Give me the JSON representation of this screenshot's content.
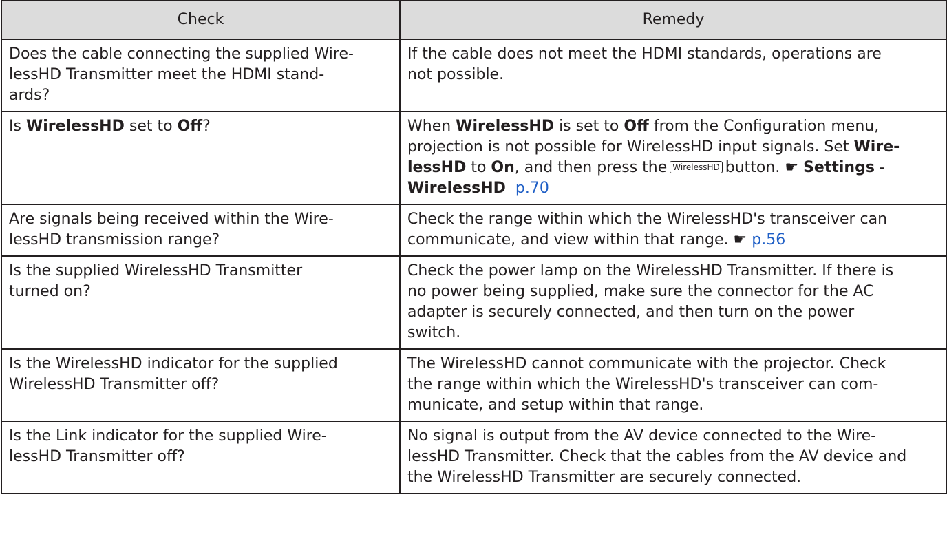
{
  "table": {
    "headers": [
      "Check",
      "Remedy"
    ],
    "rows": [
      {
        "check": [
          "Does the cable connecting the supplied Wire-",
          "lessHD Transmitter meet the HDMI stand-",
          "ards?"
        ],
        "remedy": [
          "If the cable does not meet the HDMI standards, operations are",
          "not possible."
        ]
      },
      {
        "check": {
          "t1": "Is ",
          "b1": "WirelessHD",
          "t2": " set to ",
          "b2": "Off",
          "t3": "?"
        },
        "remedy": {
          "t1": "When ",
          "b1": "WirelessHD",
          "t2": " is set to ",
          "b2": "Off",
          "t3": " from the Configuration menu,",
          "t4": "projection is not possible for WirelessHD input signals. Set ",
          "b3": "Wire-",
          "b4": "lessHD",
          "t5": " to ",
          "b5": "On",
          "t6": ", and then press the",
          "button": "WirelessHD",
          "t7": "button.",
          "finger": "☛",
          "b6": "Settings",
          "t8": " -",
          "b7": "WirelessHD",
          "link": "p.70"
        }
      },
      {
        "check": [
          "Are signals being received within the Wire-",
          "lessHD transmission range?"
        ],
        "remedy": {
          "l1": "Check the range within which the WirelessHD's transceiver can",
          "l2": "communicate, and view within that range.",
          "finger": "☛",
          "link": "p.56"
        }
      },
      {
        "check": [
          "Is the supplied WirelessHD Transmitter",
          "turned on?"
        ],
        "remedy": [
          "Check the power lamp on the WirelessHD Transmitter. If there is",
          "no power being supplied, make sure the connector for the AC",
          "adapter is securely connected, and then turn on the power",
          "switch."
        ]
      },
      {
        "check": [
          "Is the WirelessHD indicator for the supplied",
          "WirelessHD Transmitter off?"
        ],
        "remedy": [
          "The WirelessHD cannot communicate with the projector. Check",
          "the range within which the WirelessHD's transceiver can com-",
          "municate, and setup within that range."
        ]
      },
      {
        "check": [
          "Is the Link indicator for the supplied Wire-",
          "lessHD Transmitter off?"
        ],
        "remedy": [
          "No signal is output from the AV device connected to the Wire-",
          "lessHD Transmitter. Check that the cables from the AV device and",
          "the WirelessHD Transmitter are securely connected."
        ]
      }
    ]
  }
}
